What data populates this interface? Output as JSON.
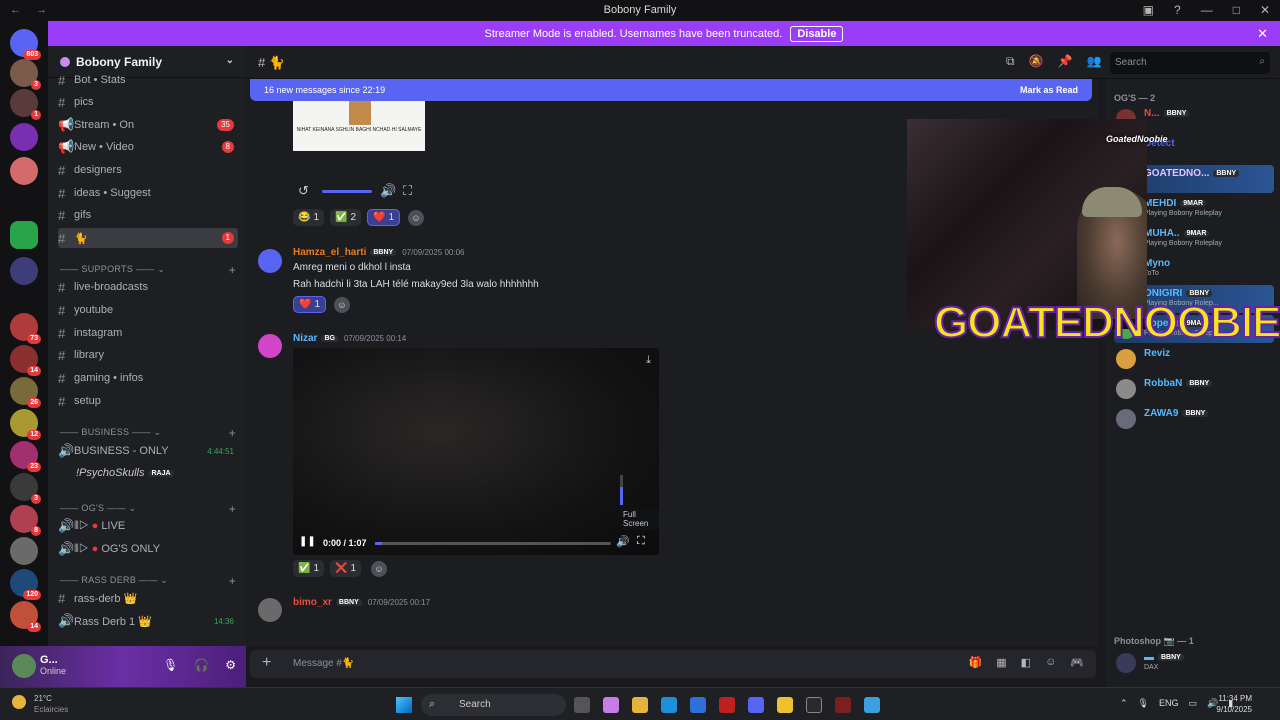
{
  "window": {
    "title": "Bobony Family",
    "nav": "← →"
  },
  "banner": {
    "text": "Streamer Mode is enabled. Usernames have been truncated.",
    "button": "Disable"
  },
  "guild": {
    "name": "Bobony Family"
  },
  "channels": [
    {
      "label": "Bot • Stats",
      "prefix": "#"
    },
    {
      "label": "pics",
      "prefix": "#"
    },
    {
      "label": "Stream • On",
      "prefix": "📢",
      "badge": "35"
    },
    {
      "label": "New • Video",
      "prefix": "📢",
      "badge": "8"
    },
    {
      "label": "designers",
      "prefix": "#"
    },
    {
      "label": "ideas • Suggest",
      "prefix": "#"
    },
    {
      "label": "gifs",
      "prefix": "#"
    },
    {
      "label": "🐈",
      "prefix": "#",
      "badge": "1"
    }
  ],
  "support_cat": "SUPPORTS",
  "support_channels": [
    "live-broadcasts",
    "youtube",
    "instagram",
    "library",
    "gaming • infos",
    "setup"
  ],
  "business_cat": "BUSINESS",
  "business_voice": {
    "label": "BUSINESS - ONLY",
    "time": "4:44:51"
  },
  "business_user": {
    "name": "!PsychoSkulls",
    "tag": "RAJA"
  },
  "ogs_cat": "OG'S",
  "ogs_voice": [
    "LIVE",
    "OG'S ONLY"
  ],
  "rass_cat": "RASS DERB",
  "rass_channels": [
    {
      "label": "rass-derb 👑",
      "prefix": "#"
    },
    {
      "label": "Rass Derb 1 👑",
      "time": "14:36"
    }
  ],
  "user": {
    "name": "G...",
    "status": "Online"
  },
  "header": {
    "channel": "🐈",
    "search_placeholder": "Search"
  },
  "newbar": {
    "text": "16 new messages since 22:19",
    "mark": "Mark as Read"
  },
  "image_caption": "NIHAT KEINANA SGHLIN BAGHI NCHAD HI SALMAYE",
  "reactions1": [
    {
      "e": "😂",
      "n": "1"
    },
    {
      "e": "✅",
      "n": "2"
    },
    {
      "e": "❤️",
      "n": "1"
    }
  ],
  "msg1": {
    "name": "Hamza_el_harti",
    "tag": "BBNY",
    "time": "07/09/2025 00:06",
    "lines": [
      "Amreg meni o dkhol l insta",
      "Rah hadchi li 3ta LAH télé makay9ed 3la walo hhhhhhh"
    ],
    "react": {
      "e": "❤️",
      "n": "1"
    }
  },
  "msg2": {
    "name": "Nizar",
    "tag": "BG",
    "time": "07/09/2025 00:14"
  },
  "video": {
    "time": "0:00 / 1:07",
    "tooltip": "Full Screen",
    "progress_pct": 3
  },
  "reactions2": [
    {
      "e": "✅",
      "n": "1"
    },
    {
      "e": "❌",
      "n": "1"
    }
  ],
  "msg3": {
    "name": "bimo_xr",
    "tag": "BBNY",
    "time": "07/09/2025 00:17"
  },
  "composer": {
    "placeholder": "Message #🐈"
  },
  "members_cat": "OG'S — 2",
  "members": [
    {
      "name": "N...",
      "tag": "BBNY",
      "color": "#e74c3c"
    },
    {
      "name": "Detect",
      "tag": "",
      "color": "#5865f2"
    },
    {
      "name": "GOATEDNO...",
      "tag": "BBNY",
      "color": "#e6c1ff",
      "hl": true
    },
    {
      "name": "MEHDI",
      "tag": "9MAR",
      "act": "Playing Bobony Roleplay",
      "color": "#58b9ff"
    },
    {
      "name": "MUHA..",
      "tag": "9MAR",
      "act": "Playing Bobony Roleplay",
      "color": "#58b9ff"
    },
    {
      "name": "Myno",
      "tag": "",
      "act": "ToTo",
      "color": "#58b9ff"
    },
    {
      "name": "ONIGIRI",
      "tag": "BBNY",
      "act": "Playing Bobony Rolep...",
      "color": "#58b9ff",
      "hl": true
    },
    {
      "name": "Popeye",
      "tag": "9MAR",
      "act": "Playing Bobony Roleplay",
      "color": "#58b9ff",
      "hl": true
    },
    {
      "name": "Reviz",
      "tag": "",
      "color": "#58b9ff"
    },
    {
      "name": "RobbaN",
      "tag": "BBNY",
      "color": "#58b9ff"
    },
    {
      "name": "ZAWA9",
      "tag": "BBNY",
      "color": "#58b9ff"
    }
  ],
  "members_cat2": "Photoshop 📷 — 1",
  "member_ps": {
    "name": "DAX",
    "tag": "BBNY"
  },
  "webcam": {
    "label": "GoatedNoobie",
    "overlay": "GOATEDNOOBIE"
  },
  "taskbar": {
    "temp": "21°C",
    "cond": "Eclaircies",
    "search": "Search",
    "lang": "ENG",
    "time": "11:34 PM",
    "date": "9/10/2025"
  }
}
